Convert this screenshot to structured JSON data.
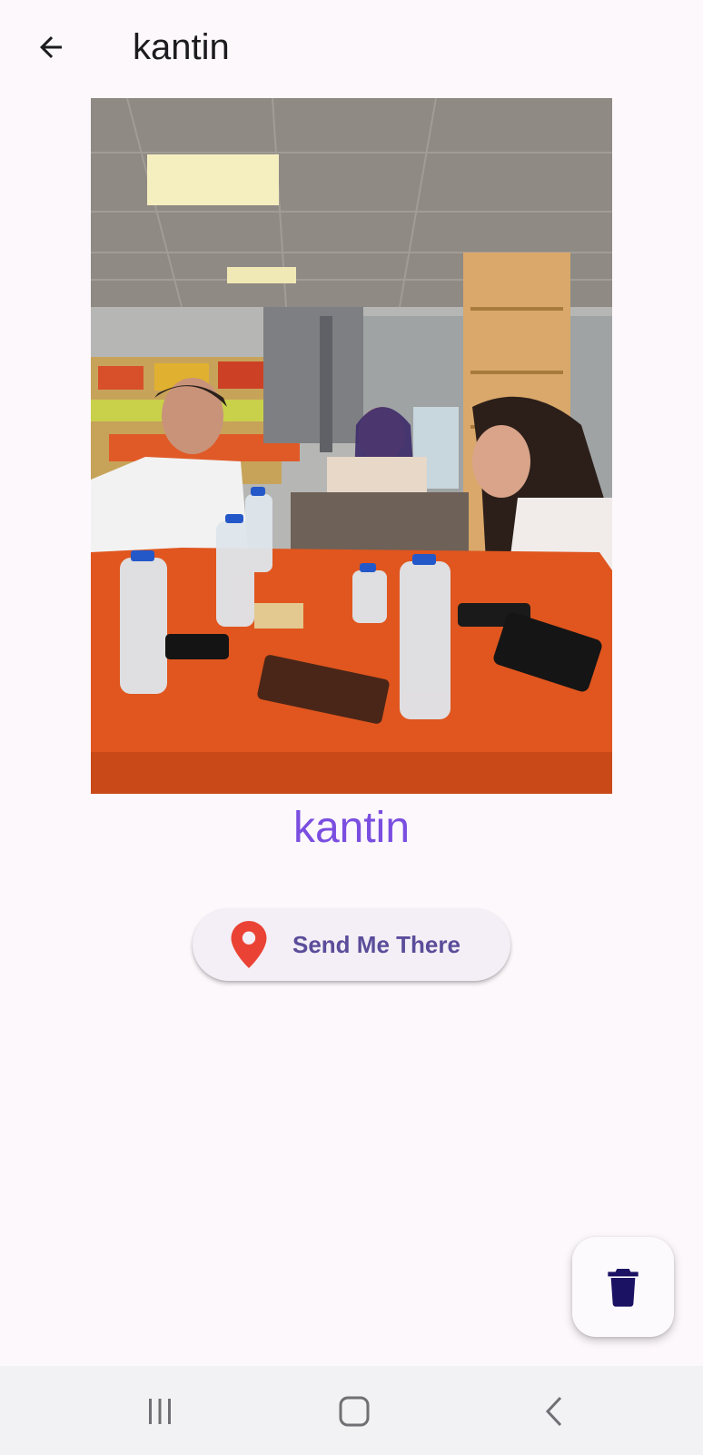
{
  "app_bar": {
    "title": "kantin",
    "back_icon": "arrow-left-icon"
  },
  "photo": {
    "description_icon": "place-photo"
  },
  "place": {
    "name": "kantin"
  },
  "send_button": {
    "label": "Send Me There",
    "icon": "location-pin-icon",
    "icon_color": "#ea4335"
  },
  "fab": {
    "icon": "trash-icon",
    "icon_color": "#1b1264"
  },
  "system_nav": {
    "recents_icon": "recents-icon",
    "home_icon": "home-icon",
    "back_icon": "nav-back-icon"
  },
  "colors": {
    "accent": "#7a4ee0",
    "button_text": "#5b4d9a",
    "background": "#fdf8fc"
  }
}
